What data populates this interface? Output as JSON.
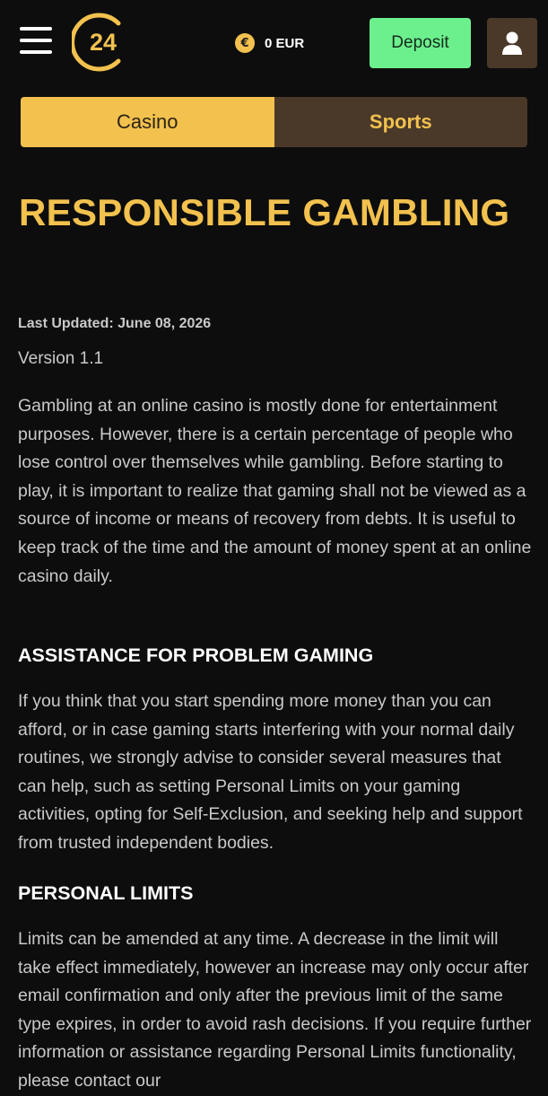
{
  "header": {
    "logo_text": "24",
    "balance": {
      "currency_symbol": "€",
      "text": "0 EUR"
    },
    "deposit_label": "Deposit",
    "icons": {
      "menu": "hamburger-menu-icon",
      "user": "user-icon",
      "coin": "euro-coin-icon"
    }
  },
  "tabs": [
    {
      "label": "Casino",
      "active": true
    },
    {
      "label": "Sports",
      "active": false
    }
  ],
  "colors": {
    "background": "#0d0d0d",
    "accent": "#f2c14e",
    "deposit": "#6cf08e",
    "tab_inactive": "#4a3929",
    "body_text": "#c9c9c9",
    "heading_text": "#ffffff"
  },
  "content": {
    "title": "RESPONSIBLE GAMBLING",
    "last_updated": "Last Updated: June 08, 2026",
    "version": "Version 1.1",
    "intro": "Gambling at an online casino is mostly done for entertainment purposes. However, there is a certain percentage of people who lose control over themselves while gambling. Before starting to play, it is important to realize that gaming shall not be viewed as a source of income or means of recovery from debts. It is useful to keep track of the time and the amount of money spent at an online casino daily.",
    "sections": [
      {
        "heading": "ASSISTANCE FOR PROBLEM GAMING",
        "text": "If you think that you start spending more money than you can afford, or in case gaming starts interfering with your normal daily routines, we strongly advise to consider several measures that can help, such as setting Personal Limits on your gaming activities, opting for Self-Exclusion, and seeking help and support from trusted independent bodies."
      },
      {
        "heading": "PERSONAL LIMITS",
        "text": "Limits can be amended at any time. A decrease in the limit will take effect immediately, however an increase may only occur after email confirmation and only after the previous limit of the same type expires, in order to avoid rash decisions. If you require further information or assistance regarding Personal Limits functionality, please contact our"
      }
    ]
  }
}
